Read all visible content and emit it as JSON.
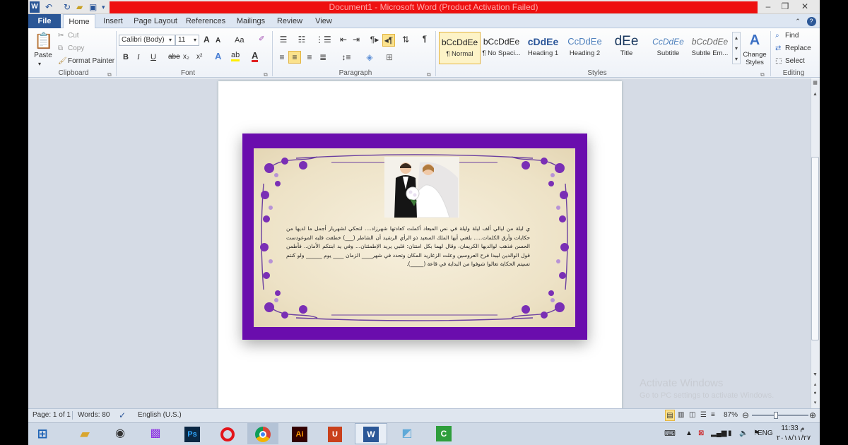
{
  "window": {
    "title": "Document1  -  Microsoft Word (Product Activation Failed)",
    "app_icon": "W",
    "controls": {
      "minimize": "–",
      "restore": "❐",
      "close": "✕"
    }
  },
  "tabs": [
    {
      "label": "File"
    },
    {
      "label": "Home"
    },
    {
      "label": "Insert"
    },
    {
      "label": "Page Layout"
    },
    {
      "label": "References"
    },
    {
      "label": "Mailings"
    },
    {
      "label": "Review"
    },
    {
      "label": "View"
    }
  ],
  "ribbon": {
    "clipboard": {
      "label": "Clipboard",
      "paste": "Paste",
      "cut": "Cut",
      "copy": "Copy",
      "format_painter": "Format Painter"
    },
    "font": {
      "label": "Font",
      "font_name": "Calibri (Body)",
      "font_size": "11",
      "grow": "A",
      "shrink": "A",
      "case": "Aa",
      "bold": "B",
      "italic": "I",
      "underline": "U",
      "strike": "abe",
      "subscript": "x₂",
      "superscript": "x²"
    },
    "paragraph": {
      "label": "Paragraph",
      "pilcrow": "¶"
    },
    "styles": {
      "label": "Styles",
      "items": [
        {
          "sample": "bCcDdEe",
          "name": "¶ Normal"
        },
        {
          "sample": "bCcDdEe",
          "name": "¶ No Spaci..."
        },
        {
          "sample": "cDdEe",
          "name": "Heading 1"
        },
        {
          "sample": "CcDdEe",
          "name": "Heading 2"
        },
        {
          "sample": "dEe",
          "name": "Title"
        },
        {
          "sample": "CcDdEe",
          "name": "Subtitle"
        },
        {
          "sample": "bCcDdEe",
          "name": "Subtle Em..."
        }
      ],
      "change_styles": "Change Styles"
    },
    "editing": {
      "label": "Editing",
      "find": "Find",
      "replace": "Replace",
      "select": "Select"
    }
  },
  "document": {
    "card_text": "ي ليلة من ليالي ألف ليلة وليلة في نص الميعاد أكملت كعادتها شهرزاد.... لتحكي لشهريار أجمل ما لديها من حكايات وأرق الكلمات..... بلغني أيها الملك السعيد ذو الرأي الرشيد أن الشاطر (___) خطفت قلبه الموعودست الحسن فذهب لوالديها الكريمان، وقال لهما بكل امتنان: قلبي يريد الإطمئنان... وفي يد ابنتكم الأمان.. فأطمن قول الوالدين ليبدا فرح العروسين وعلت الزغاريد المكان وتحدد في شهر____ الزمان ____ يوم ______ ولو كنتم تسيتم الحكاية تعالوا شوفوا من البداية في قاعة (_____)."
  },
  "status": {
    "page": "Page: 1 of 1",
    "words": "Words: 80",
    "language": "English (U.S.)",
    "zoom": "87%",
    "zoom_level": 0.87
  },
  "watermark": {
    "line1": "Activate Windows",
    "line2": "Go to PC settings to activate Windows."
  },
  "taskbar": {
    "lang": "ENG",
    "time": "11:33 م",
    "date": "٢٠١٨/١١/٢٧"
  },
  "colors": {
    "title_red": "#ee1010",
    "card_purple": "#6a0dad",
    "file_tab": "#2b5797"
  }
}
